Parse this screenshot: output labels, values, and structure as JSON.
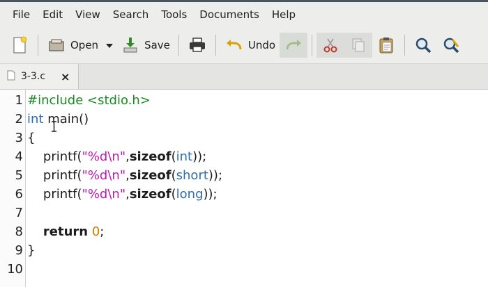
{
  "menu": [
    "File",
    "Edit",
    "View",
    "Search",
    "Tools",
    "Documents",
    "Help"
  ],
  "toolbar": {
    "open_label": "Open",
    "save_label": "Save",
    "undo_label": "Undo"
  },
  "tab": {
    "title": "3-3.c",
    "close": "×"
  },
  "editor": {
    "line_numbers": [
      "1",
      "2",
      "3",
      "4",
      "5",
      "6",
      "7",
      "8",
      "9",
      "10"
    ],
    "lines": [
      [
        {
          "t": "#include <stdio.h>",
          "c": "pp"
        }
      ],
      [
        {
          "t": "int",
          "c": "kw"
        },
        {
          "t": " main()",
          "c": ""
        }
      ],
      [
        {
          "t": "{",
          "c": ""
        }
      ],
      [
        {
          "t": "    printf(",
          "c": ""
        },
        {
          "t": "\"%d\\n\"",
          "c": "str"
        },
        {
          "t": ",",
          "c": ""
        },
        {
          "t": "sizeof",
          "c": "bold"
        },
        {
          "t": "(",
          "c": ""
        },
        {
          "t": "int",
          "c": "kw"
        },
        {
          "t": "));",
          "c": ""
        }
      ],
      [
        {
          "t": "    printf(",
          "c": ""
        },
        {
          "t": "\"%d\\n\"",
          "c": "str"
        },
        {
          "t": ",",
          "c": ""
        },
        {
          "t": "sizeof",
          "c": "bold"
        },
        {
          "t": "(",
          "c": ""
        },
        {
          "t": "short",
          "c": "kw"
        },
        {
          "t": "));",
          "c": ""
        }
      ],
      [
        {
          "t": "    printf(",
          "c": ""
        },
        {
          "t": "\"%d\\n\"",
          "c": "str"
        },
        {
          "t": ",",
          "c": ""
        },
        {
          "t": "sizeof",
          "c": "bold"
        },
        {
          "t": "(",
          "c": ""
        },
        {
          "t": "long",
          "c": "kw"
        },
        {
          "t": "));",
          "c": ""
        }
      ],
      [],
      [
        {
          "t": "    ",
          "c": ""
        },
        {
          "t": "return",
          "c": "bold"
        },
        {
          "t": " ",
          "c": ""
        },
        {
          "t": "0",
          "c": "num"
        },
        {
          "t": ";",
          "c": ""
        }
      ],
      [
        {
          "t": "}",
          "c": ""
        }
      ],
      []
    ]
  },
  "colors": {
    "preprocessor": "#1b8b24",
    "keyword": "#2e6ca8",
    "string": "#c416b9",
    "number": "#d07800"
  }
}
